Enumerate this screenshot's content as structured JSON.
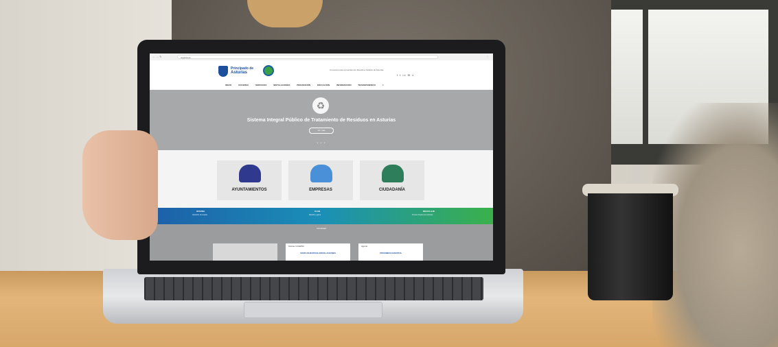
{
  "browser": {
    "address": "cogersa.es",
    "controls": "← → ↻",
    "menu": "⋮"
  },
  "site": {
    "logo_text_1": "Principado de",
    "logo_text_2": "Asturias",
    "header_info": "Consorcio para la Gestión de Residuos Sólidos de Asturias",
    "header_icons": "f t in ✉ ⌕",
    "nav": [
      "INICIO",
      "COGERSA",
      "SERVICIOS",
      "INSTALACIONES",
      "PREVENCIÓN",
      "EDUCACIÓN",
      "INFORMACIÓN",
      "TRANSPARENCIA",
      "≡"
    ],
    "hero_title": "Sistema Integral Público de Tratamiento de Residuos en Asturias",
    "hero_button": "Ver más",
    "hero_dots": "• • •",
    "cards": [
      {
        "label": "AYUNTAMIENTOS",
        "color": "#2f3a8f"
      },
      {
        "label": "EMPRESAS",
        "color": "#4a90d9"
      },
      {
        "label": "CIUDADANÍA",
        "color": "#2e7d5b"
      }
    ],
    "band": [
      {
        "title": "OFICINA",
        "sub": "Atención al usuario"
      },
      {
        "title": "CLUB",
        "sub": "Recicla y gana"
      },
      {
        "title": "RECICLAJE",
        "sub": "Puntos limpios de Asturias"
      }
    ],
    "grey_title": "Actualidad",
    "tiles": [
      {
        "t1": "",
        "t2": ""
      },
      {
        "t1": "Noticias COGERSA",
        "t2": "VISITA NUESTRAS INSTALACIONES"
      },
      {
        "t1": "Agenda",
        "t2": "PRÓXIMOS EVENTOS"
      }
    ]
  }
}
